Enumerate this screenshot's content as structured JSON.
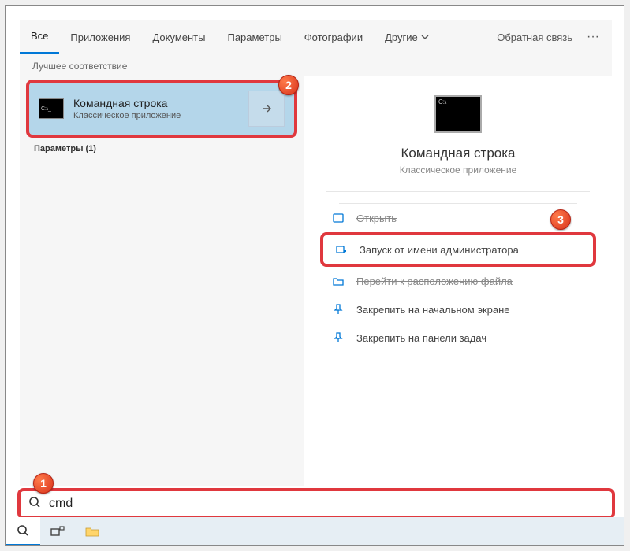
{
  "tabs": {
    "all": "Все",
    "apps": "Приложения",
    "docs": "Документы",
    "params": "Параметры",
    "photos": "Фотографии",
    "more": "Другие"
  },
  "feedback": "Обратная связь",
  "group_header": "Лучшее соответствие",
  "best_match": {
    "title": "Командная строка",
    "subtitle": "Классическое приложение"
  },
  "params_strip": "Параметры (1)",
  "right": {
    "title": "Командная строка",
    "subtitle": "Классическое приложение"
  },
  "actions": {
    "open_scratched": "Открыть",
    "run_admin": "Запуск от имени администратора",
    "open_location_scratched": "Перейти к расположению файла",
    "pin_start": "Закрепить на начальном экране",
    "pin_taskbar": "Закрепить на панели задач"
  },
  "search": {
    "value": "cmd"
  },
  "badges": {
    "b1": "1",
    "b2": "2",
    "b3": "3"
  }
}
